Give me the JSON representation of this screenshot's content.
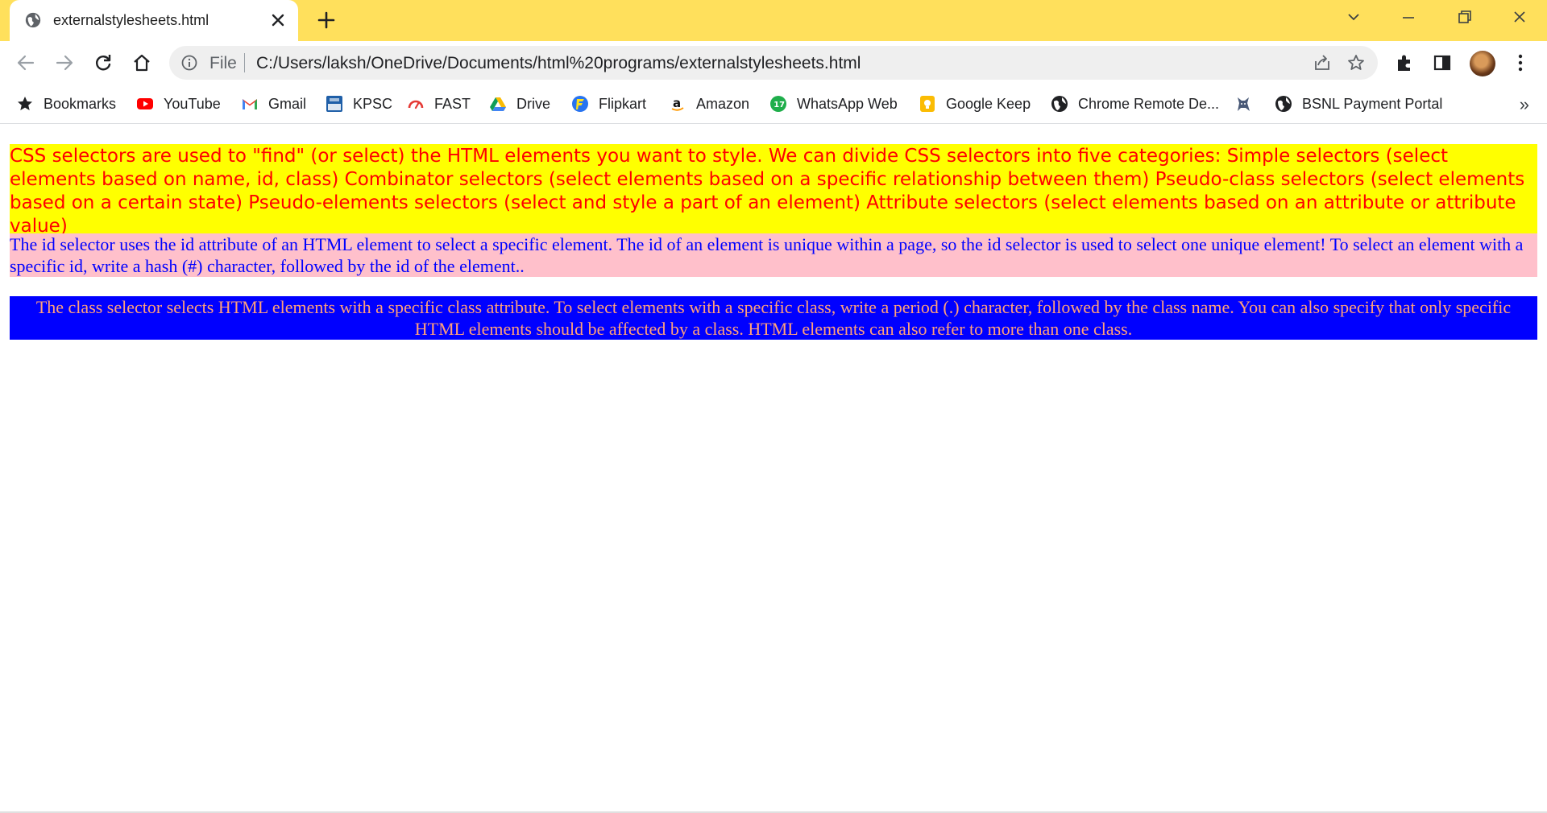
{
  "browser": {
    "tab": {
      "title": "externalstylesheets.html"
    },
    "omnibox": {
      "scheme_label": "File",
      "url": "C:/Users/laksh/OneDrive/Documents/html%20programs/externalstylesheets.html"
    },
    "colors": {
      "tabstrip": "#ffe05c",
      "omnibox": "#efefef"
    }
  },
  "bookmarks": [
    {
      "label": "Bookmarks",
      "icon": "star-icon"
    },
    {
      "label": "YouTube",
      "icon": "youtube-icon"
    },
    {
      "label": "Gmail",
      "icon": "gmail-icon"
    },
    {
      "label": "KPSC",
      "icon": "kpsc-icon"
    },
    {
      "label": "FAST",
      "icon": "fast-icon"
    },
    {
      "label": "Drive",
      "icon": "drive-icon"
    },
    {
      "label": "Flipkart",
      "icon": "flipkart-icon"
    },
    {
      "label": "Amazon",
      "icon": "amazon-icon"
    },
    {
      "label": "WhatsApp Web",
      "icon": "whatsapp-icon"
    },
    {
      "label": "Google Keep",
      "icon": "keep-icon"
    },
    {
      "label": "Chrome Remote De...",
      "icon": "globe-icon"
    },
    {
      "label": "",
      "icon": "wolf-icon"
    },
    {
      "label": "BSNL Payment Portal",
      "icon": "globe-icon"
    }
  ],
  "page": {
    "paragraphs": [
      {
        "text": "CSS selectors are used to \"find\" (or select) the HTML elements you want to style. We can divide CSS selectors into five categories: Simple selectors (select elements based on name, id, class) Combinator selectors (select elements based on a specific relationship between them) Pseudo-class selectors (select elements based on a certain state) Pseudo-elements selectors (select and style a part of an element) Attribute selectors (select elements based on an attribute or attribute value)",
        "background": "#ffff00",
        "color": "#ff0000"
      },
      {
        "text": "The id selector uses the id attribute of an HTML element to select a specific element. The id of an element is unique within a page, so the id selector is used to select one unique element! To select an element with a specific id, write a hash (#) character, followed by the id of the element..",
        "background": "#ffc0cb",
        "color": "#0000ff"
      },
      {
        "text": "The class selector selects HTML elements with a specific class attribute. To select elements with a specific class, write a period (.) character, followed by the class name. You can also specify that only specific HTML elements should be affected by a class. HTML elements can also refer to more than one class.",
        "background": "#0000ff",
        "color": "#ffa07a"
      }
    ]
  }
}
